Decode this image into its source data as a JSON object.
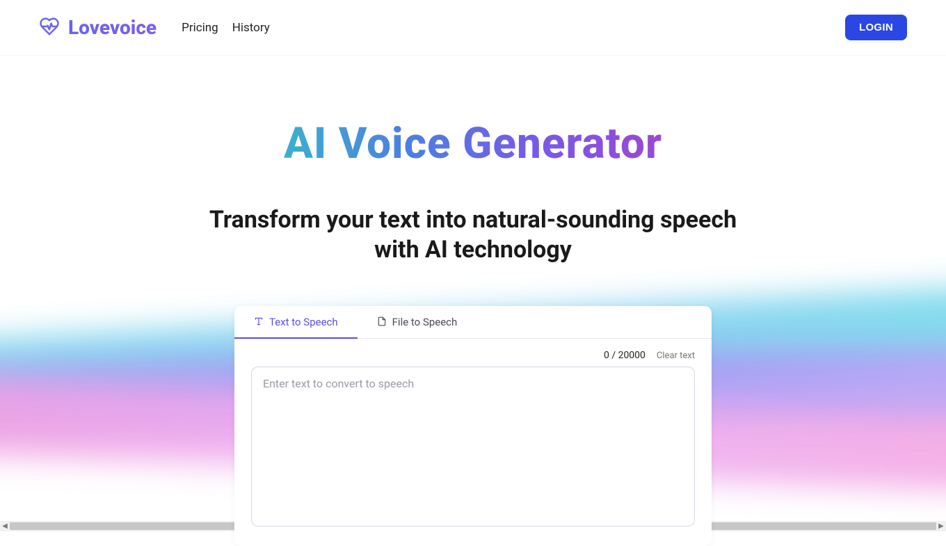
{
  "header": {
    "brand": "Lovevoice",
    "nav": {
      "pricing": "Pricing",
      "history": "History"
    },
    "login": "LOGIN"
  },
  "hero": {
    "title": "AI Voice Generator",
    "subtitle": "Transform your text into natural-sounding speech with AI technology"
  },
  "card": {
    "tabs": {
      "text": "Text to Speech",
      "file": "File to Speech"
    },
    "counter": "0 / 20000",
    "clear": "Clear text",
    "placeholder": "Enter text to convert to speech",
    "value": ""
  }
}
